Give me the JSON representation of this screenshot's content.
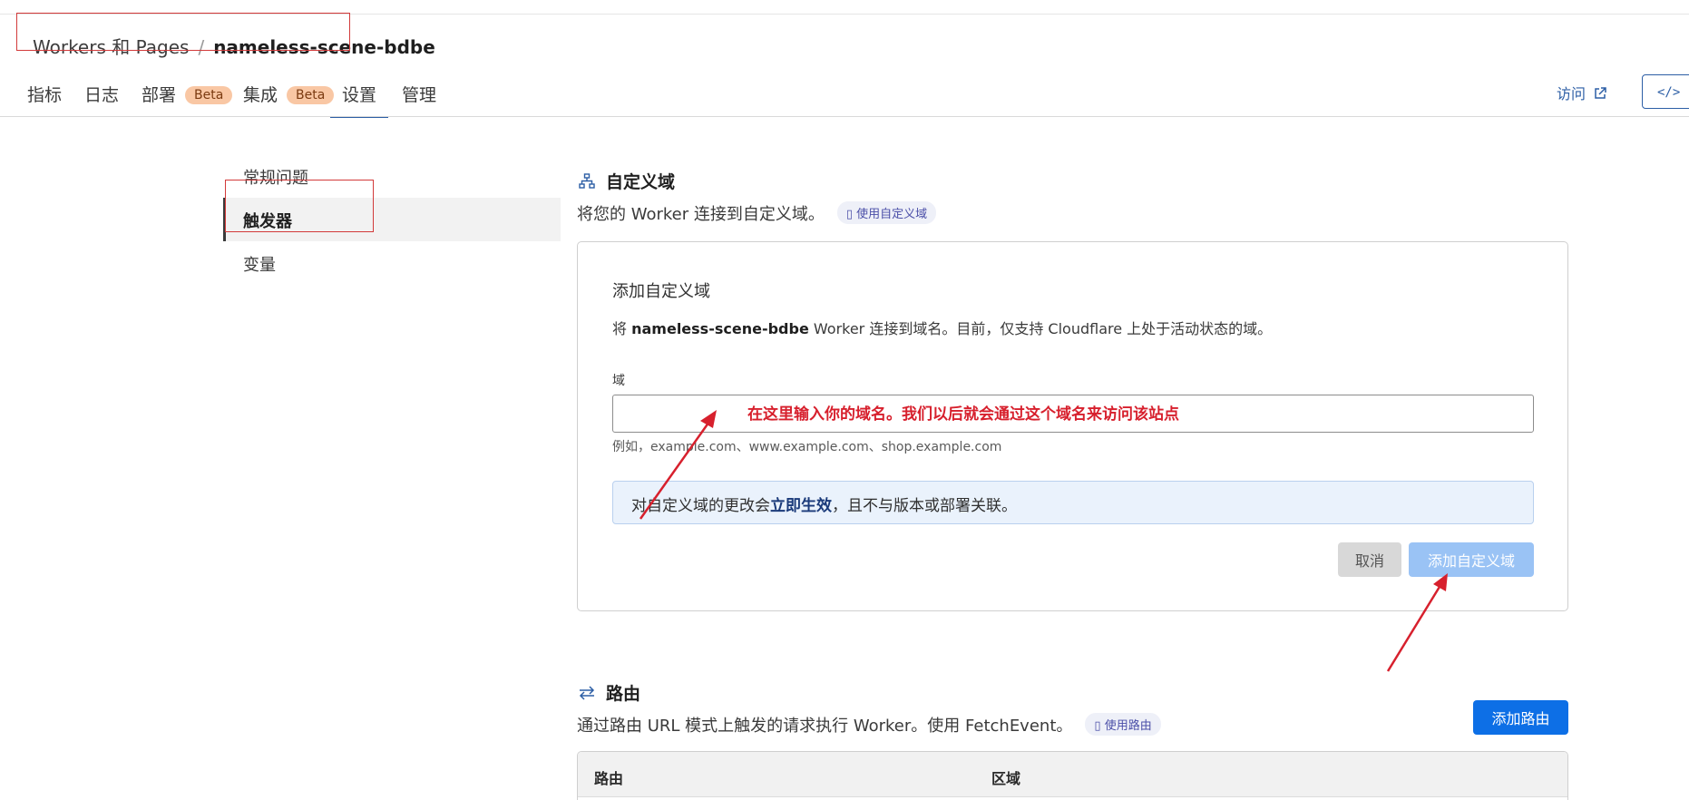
{
  "breadcrumb": {
    "parent": "Workers 和 Pages",
    "separator": "/",
    "current": "nameless-scene-bdbe"
  },
  "tabs": [
    {
      "label": "指标"
    },
    {
      "label": "日志"
    },
    {
      "label": "部署",
      "badge": "Beta"
    },
    {
      "label": "集成",
      "badge": "Beta"
    },
    {
      "label": "设置",
      "active": true
    },
    {
      "label": "管理"
    }
  ],
  "header_actions": {
    "visit_label": "访问",
    "visit_icon": "external-link-icon",
    "edit_icon": "code-icon",
    "edit_label_visible": "</>  编"
  },
  "sidenav": {
    "items": [
      {
        "label": "常规问题"
      },
      {
        "label": "触发器",
        "active": true
      },
      {
        "label": "变量"
      }
    ]
  },
  "custom_domain": {
    "icon": "sitemap-icon",
    "title": "自定义域",
    "description": "将您的 Worker 连接到自定义域。",
    "doc_pill": "使用自定义域",
    "card": {
      "title": "添加自定义域",
      "desc_prefix": "将",
      "desc_worker": "nameless-scene-bdbe",
      "desc_suffix": "Worker 连接到域名。目前，仅支持 Cloudflare 上处于活动状态的域。",
      "field_label": "域",
      "input_value": "",
      "hint": "例如，example.com、www.example.com、shop.example.com",
      "banner_prefix": "对自定义域的更改会",
      "banner_bold": "立即生效",
      "banner_suffix": "，且不与版本或部署关联。",
      "cancel_label": "取消",
      "add_label": "添加自定义域"
    }
  },
  "routes": {
    "icon": "arrows-swap-icon",
    "title": "路由",
    "description": "通过路由 URL 模式上触发的请求执行 Worker。使用 FetchEvent。",
    "doc_pill": "使用路由",
    "add_button": "添加路由",
    "columns": [
      "路由",
      "区域"
    ]
  },
  "annotation": {
    "text": "在这里输入你的域名。我们以后就会通过这个域名来访问该站点",
    "color": "#d7202d"
  },
  "colors": {
    "accent": "#2c5ea5",
    "primary_button": "#0d6fe6",
    "disabled_button": "#9ac3f5",
    "badge_bg": "#f9c7a4",
    "annotation_red": "#d7202d"
  }
}
